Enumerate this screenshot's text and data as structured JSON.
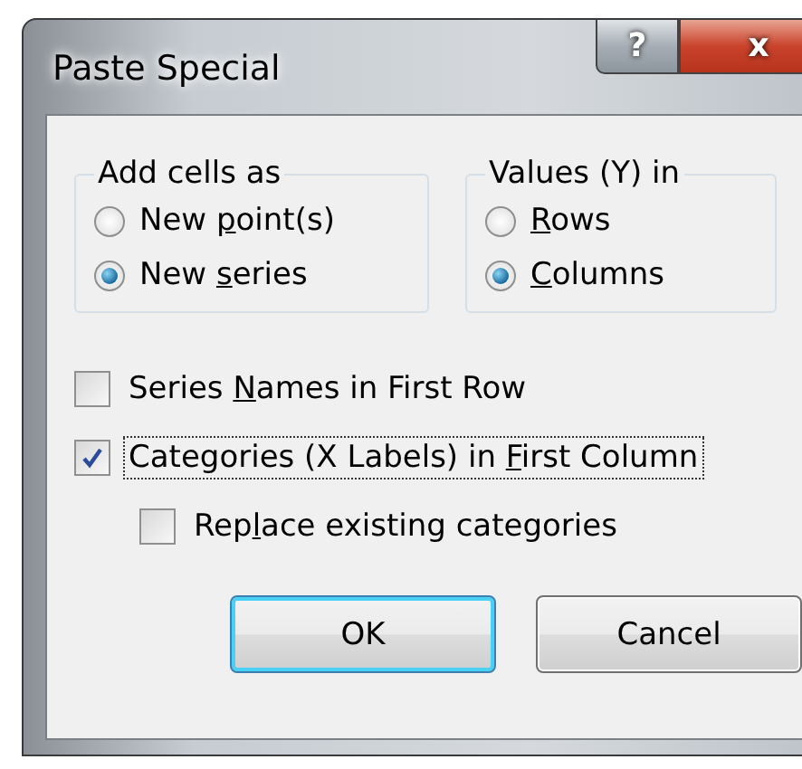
{
  "window": {
    "title": "Paste Special",
    "help_button": "?",
    "close_button": "x"
  },
  "groups": [
    {
      "title": "Add cells as",
      "options": [
        {
          "label": {
            "before": "New ",
            "key": "p",
            "after": "oint(s)"
          },
          "selected": false
        },
        {
          "label": {
            "before": "New ",
            "key": "s",
            "after": "eries"
          },
          "selected": true
        }
      ]
    },
    {
      "title": "Values (Y) in",
      "options": [
        {
          "label": {
            "key": "R",
            "after": "ows"
          },
          "selected": false
        },
        {
          "label": {
            "key": "C",
            "after": "olumns"
          },
          "selected": true
        }
      ]
    }
  ],
  "checkboxes": [
    {
      "label": {
        "before": "Series ",
        "key": "N",
        "after": "ames in First Row"
      },
      "checked": false,
      "focused": false
    },
    {
      "label": {
        "before": "Categories (X Labels) in ",
        "key": "F",
        "after": "irst Column"
      },
      "checked": true,
      "focused": true,
      "children": [
        {
          "label": {
            "before": "Rep",
            "key": "l",
            "after": "ace existing categories"
          },
          "checked": false,
          "focused": false
        }
      ]
    }
  ],
  "buttons": [
    {
      "label": "OK",
      "default": true
    },
    {
      "label": "Cancel",
      "default": false
    }
  ]
}
